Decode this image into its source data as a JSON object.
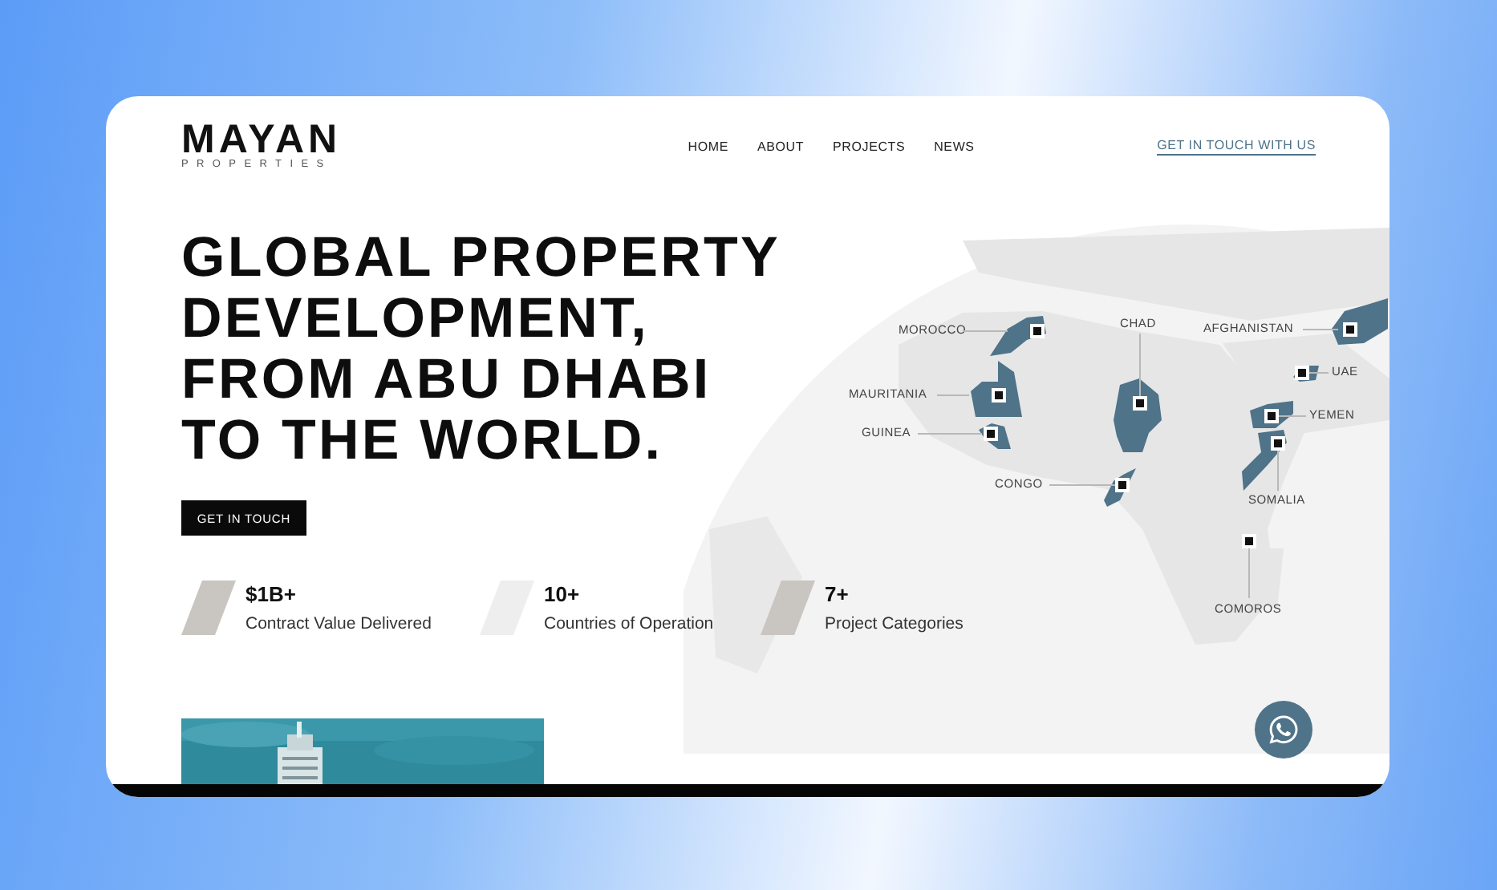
{
  "logo": {
    "name": "MAYAN",
    "tagline": "PROPERTIES"
  },
  "nav": [
    {
      "label": "HOME"
    },
    {
      "label": "ABOUT"
    },
    {
      "label": "PROJECTS"
    },
    {
      "label": "NEWS"
    }
  ],
  "header_link": "GET IN TOUCH WITH US",
  "hero": {
    "title_lines": [
      "GLOBAL PROPERTY",
      "DEVELOPMENT,",
      "FROM ABU DHABI",
      "TO THE WORLD."
    ],
    "button": "GET IN TOUCH"
  },
  "stats": [
    {
      "value": "$1B+",
      "label": "Contract Value Delivered",
      "color": "#c9c5c0"
    },
    {
      "value": "10+",
      "label": "Countries of Operation",
      "color": "#eeeeee"
    },
    {
      "value": "7+",
      "label": "Project Categories",
      "color": "#c9c5c0"
    }
  ],
  "map": {
    "countries": [
      {
        "name": "MOROCCO"
      },
      {
        "name": "CHAD"
      },
      {
        "name": "AFGHANISTAN"
      },
      {
        "name": "UAE"
      },
      {
        "name": "MAURITANIA"
      },
      {
        "name": "GUINEA"
      },
      {
        "name": "YEMEN"
      },
      {
        "name": "SOMALIA"
      },
      {
        "name": "CONGO"
      },
      {
        "name": "COMOROS"
      }
    ]
  }
}
